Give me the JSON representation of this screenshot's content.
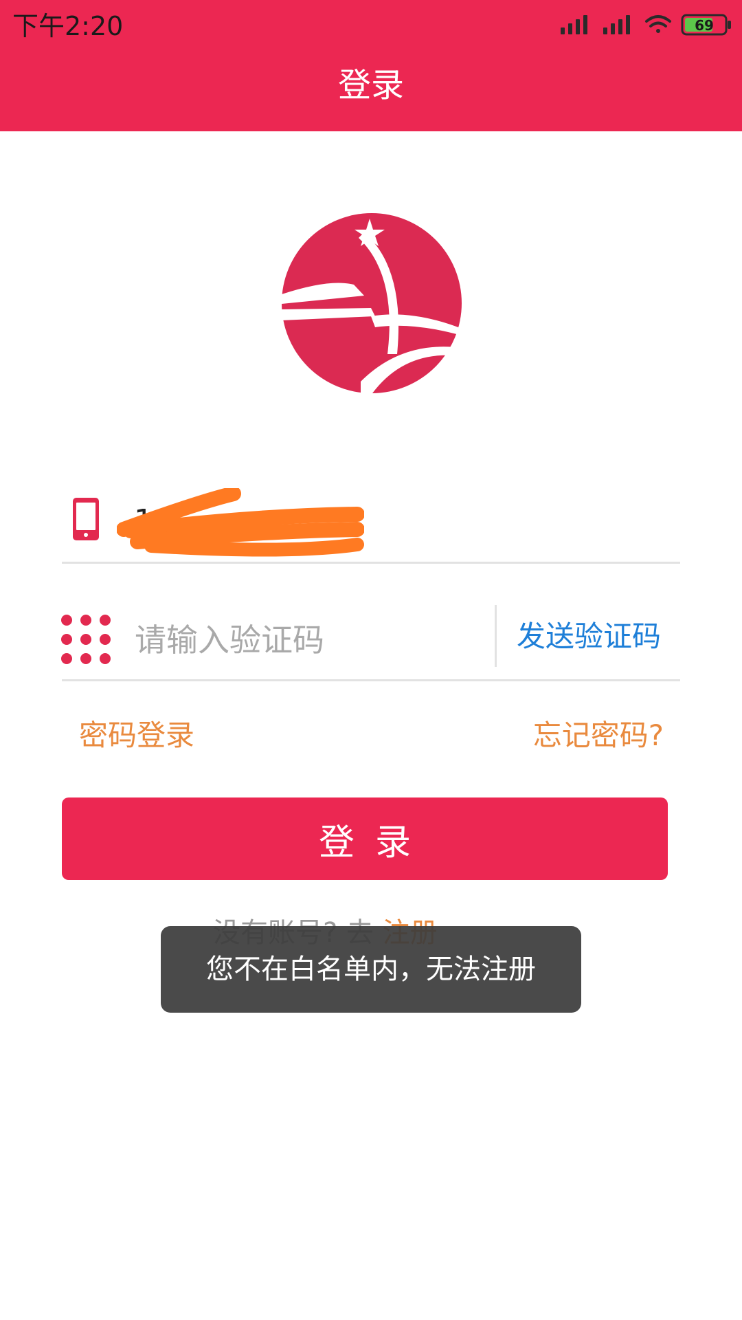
{
  "status_bar": {
    "time": "下午2:20",
    "battery": "69",
    "icons": [
      "signal-icon",
      "signal-icon",
      "wifi-icon",
      "battery-icon"
    ]
  },
  "header": {
    "title": "登录"
  },
  "form": {
    "phone_value": "1",
    "code_placeholder": "请输入验证码",
    "send_code_label": "发送验证码"
  },
  "links": {
    "password_login": "密码登录",
    "forgot_password": "忘记密码?"
  },
  "login_button_label": "登录",
  "register": {
    "prompt": "没有账号? 去",
    "link": "注册"
  },
  "toast": {
    "message": "您不在白名单内，无法注册"
  },
  "colors": {
    "brand": "#EC2752",
    "link_blue": "#1E7FD8",
    "link_orange": "#E98A3E",
    "redaction": "#FF7A22",
    "toast_bg": "#3C3C3C"
  }
}
